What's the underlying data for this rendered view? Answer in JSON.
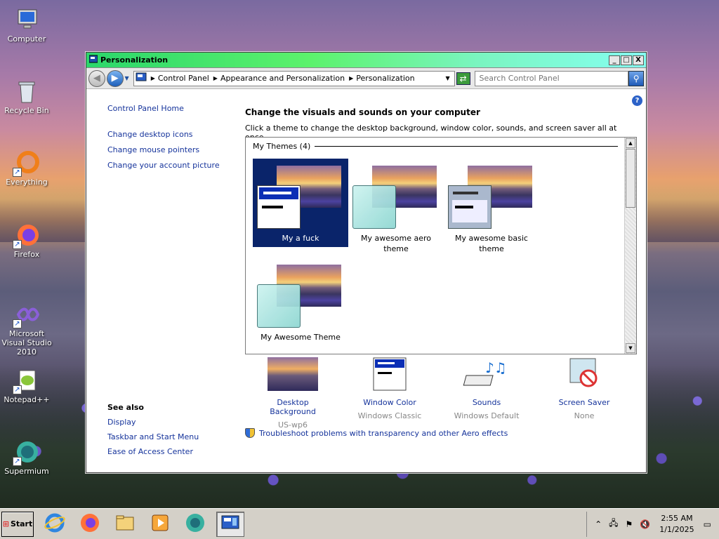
{
  "window": {
    "title": "Personalization",
    "min": "_",
    "max": "□",
    "close": "X"
  },
  "address": {
    "crumbs": [
      "Control Panel",
      "Appearance and Personalization",
      "Personalization"
    ],
    "search_placeholder": "Search Control Panel"
  },
  "sidebar": {
    "home": "Control Panel Home",
    "links": [
      "Change desktop icons",
      "Change mouse pointers",
      "Change your account picture"
    ],
    "see_also_title": "See also",
    "see_also": [
      "Display",
      "Taskbar and Start Menu",
      "Ease of Access Center"
    ]
  },
  "main": {
    "heading": "Change the visuals and sounds on your computer",
    "subtitle": "Click a theme to change the desktop background, window color, sounds, and screen saver all at once.",
    "group_label": "My Themes (4)",
    "themes": [
      {
        "name": "My a fuck",
        "style": "classic",
        "selected": true
      },
      {
        "name": "My awesome aero theme",
        "style": "aero",
        "selected": false
      },
      {
        "name": "My awesome basic theme",
        "style": "basic",
        "selected": false
      },
      {
        "name": "My Awesome Theme",
        "style": "aero",
        "selected": false
      }
    ],
    "items": [
      {
        "label": "Desktop Background",
        "value": "US-wp6"
      },
      {
        "label": "Window Color",
        "value": "Windows Classic"
      },
      {
        "label": "Sounds",
        "value": "Windows Default"
      },
      {
        "label": "Screen Saver",
        "value": "None"
      }
    ],
    "troubleshoot": "Troubleshoot problems with transparency and other Aero effects"
  },
  "desktop_icons": [
    "Computer",
    "Recycle Bin",
    "Everything",
    "Firefox",
    "Microsoft Visual Studio 2010",
    "Notepad++",
    "Supermium"
  ],
  "taskbar": {
    "start": "Start",
    "time": "2:55 AM",
    "date": "1/1/2025"
  },
  "colors": {
    "link": "#15339b",
    "selected_theme": "#0a246a",
    "titlebar_start": "#2bd66b",
    "titlebar_end": "#85fff0"
  }
}
